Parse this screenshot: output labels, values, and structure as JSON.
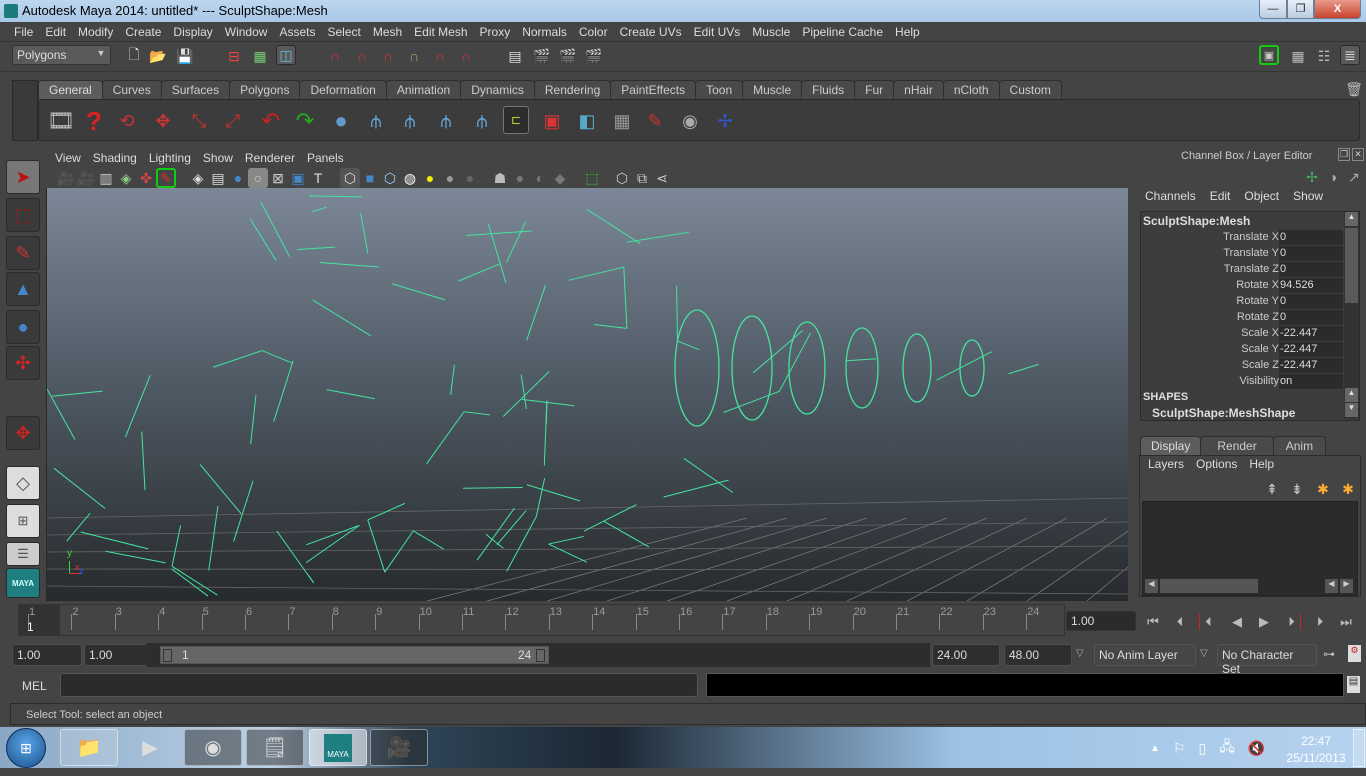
{
  "window": {
    "title": "Autodesk Maya 2014: untitled*   ---   SculptShape:Mesh",
    "minimize": "—",
    "maximize": "❐",
    "close": "X"
  },
  "menubar": [
    "File",
    "Edit",
    "Modify",
    "Create",
    "Display",
    "Window",
    "Assets",
    "Select",
    "Mesh",
    "Edit Mesh",
    "Proxy",
    "Normals",
    "Color",
    "Create UVs",
    "Edit UVs",
    "Muscle",
    "Pipeline Cache",
    "Help"
  ],
  "statusline": {
    "mode": "Polygons",
    "icons": [
      "new-scene-icon",
      "open-scene-icon",
      "save-scene-icon",
      "select-hierarchy-icon",
      "select-object-icon",
      "select-component-icon",
      "snap-grid-icon",
      "snap-curve-icon",
      "snap-point-icon",
      "snap-view-plane-icon",
      "snap-live-icon",
      "make-live-icon",
      "render-view-icon",
      "render-frame-icon",
      "ipr-render-icon",
      "render-settings-icon"
    ],
    "right_icons": [
      "modeling-toolkit-icon",
      "attribute-editor-icon",
      "tool-settings-icon",
      "channel-box-toggle-icon"
    ]
  },
  "shelf": {
    "tabs": [
      "General",
      "Curves",
      "Surfaces",
      "Polygons",
      "Deformation",
      "Animation",
      "Dynamics",
      "Rendering",
      "PaintEffects",
      "Toon",
      "Muscle",
      "Fluids",
      "Fur",
      "nHair",
      "nCloth",
      "Custom"
    ],
    "active_tab": "General",
    "icons": [
      "movie-reel-icon",
      "help-icon",
      "camera-tumble-icon",
      "camera-track-icon",
      "camera-dolly-icon",
      "camera-zoom-icon",
      "undo-icon",
      "redo-icon",
      "delete-history-icon",
      "hierarchy-icon",
      "hierarchy-2-icon",
      "parent-icon",
      "unparent-icon",
      "outliner-icon",
      "select-by-hierarchy-icon",
      "select-by-object-icon",
      "select-by-component-icon",
      "paint-select-icon",
      "universal-manipulator-icon",
      "pivot-icon"
    ]
  },
  "toolbox": [
    "select-tool-icon",
    "lasso-tool-icon",
    "paint-select-tool-icon",
    "move-tool-icon",
    "rotate-tool-icon",
    "scale-tool-icon",
    "last-tool-icon",
    "single-perspective-layout-icon",
    "four-view-layout-icon",
    "outliner-layout-icon",
    "maya-logo"
  ],
  "viewport": {
    "menus": [
      "View",
      "Shading",
      "Lighting",
      "Show",
      "Renderer",
      "Panels"
    ],
    "axis": {
      "y": "y",
      "x": "x",
      "z": "z"
    },
    "wire_color": "#44e49e"
  },
  "channel_box": {
    "title": "Channel Box / Layer Editor",
    "menus": [
      "Channels",
      "Edit",
      "Object",
      "Show"
    ],
    "object": "SculptShape:Mesh",
    "channels": [
      {
        "label": "Translate X",
        "value": "0"
      },
      {
        "label": "Translate Y",
        "value": "0"
      },
      {
        "label": "Translate Z",
        "value": "0"
      },
      {
        "label": "Rotate X",
        "value": "94.526"
      },
      {
        "label": "Rotate Y",
        "value": "0"
      },
      {
        "label": "Rotate Z",
        "value": "0"
      },
      {
        "label": "Scale X",
        "value": "-22.447"
      },
      {
        "label": "Scale Y",
        "value": "-22.447"
      },
      {
        "label": "Scale Z",
        "value": "-22.447"
      },
      {
        "label": "Visibility",
        "value": "on"
      }
    ],
    "shapes_header": "SHAPES",
    "shape": "SculptShape:MeshShape"
  },
  "layer_editor": {
    "tabs": [
      "Display",
      "Render",
      "Anim"
    ],
    "active_tab": "Display",
    "menus": [
      "Layers",
      "Options",
      "Help"
    ]
  },
  "timeline": {
    "ticks": [
      "1",
      "2",
      "3",
      "4",
      "5",
      "6",
      "7",
      "8",
      "9",
      "10",
      "11",
      "12",
      "13",
      "14",
      "15",
      "16",
      "17",
      "18",
      "19",
      "20",
      "21",
      "22",
      "23",
      "24"
    ],
    "current_frame": "1",
    "current_time": "1.00"
  },
  "range": {
    "start_time": "1.00",
    "playback_start": "1.00",
    "range_start_label": "1",
    "range_end_label": "24",
    "playback_end": "24.00",
    "end_time": "48.00",
    "anim_layer": "No Anim Layer",
    "character_set": "No Character Set"
  },
  "command_line": {
    "label": "MEL",
    "input": "",
    "help": "Select Tool: select an object"
  },
  "taskbar": {
    "apps": [
      "windows-explorer",
      "windows-media-player",
      "google-chrome",
      "notepad",
      "autodesk-maya",
      "film-app"
    ],
    "time": "22:47",
    "date": "25/11/2013"
  }
}
